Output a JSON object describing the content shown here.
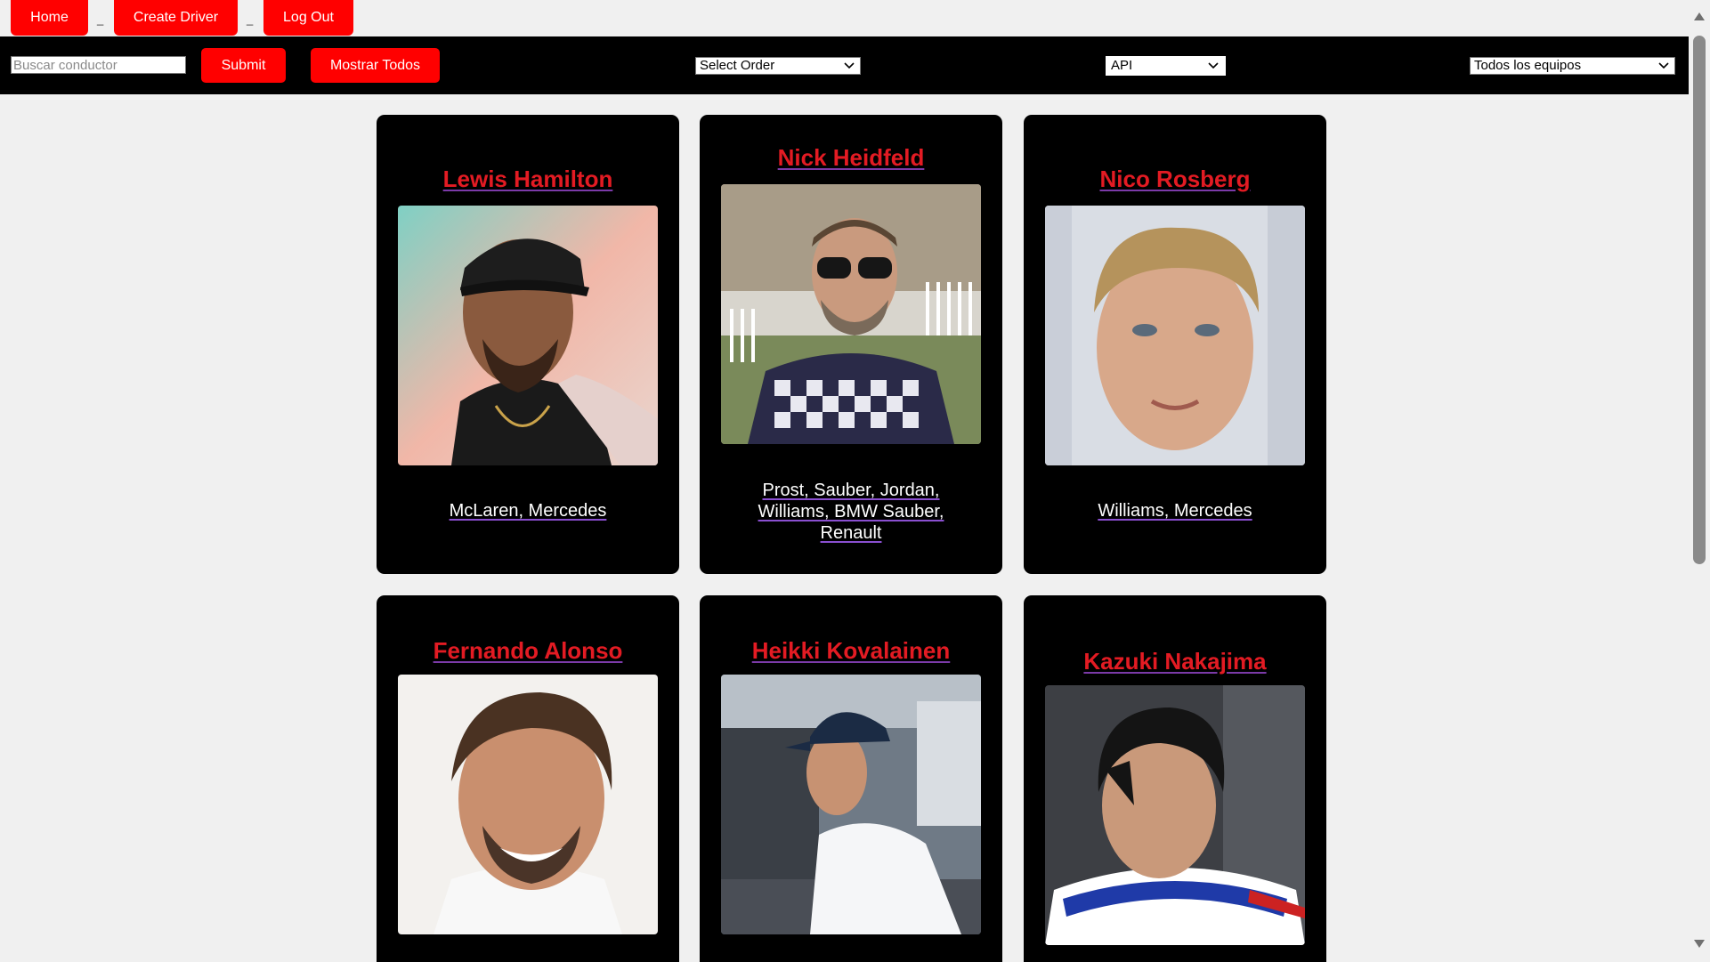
{
  "nav": {
    "home_label": "Home",
    "create_label": "Create Driver",
    "logout_label": "Log Out",
    "separator": "_"
  },
  "toolbar": {
    "search_placeholder": "Buscar conductor",
    "search_value": "",
    "submit_label": "Submit",
    "show_all_label": "Mostrar Todos",
    "order_select": "Select Order",
    "source_select": "API",
    "team_select": "Todos los equipos"
  },
  "drivers": [
    {
      "name": "Lewis Hamilton",
      "teams": "McLaren, Mercedes"
    },
    {
      "name": "Nick Heidfeld",
      "teams": "Prost, Sauber, Jordan, Williams, BMW Sauber, Renault"
    },
    {
      "name": "Nico Rosberg",
      "teams": "Williams, Mercedes"
    },
    {
      "name": "Fernando Alonso",
      "teams": ""
    },
    {
      "name": "Heikki Kovalainen",
      "teams": ""
    },
    {
      "name": "Kazuki Nakajima",
      "teams": ""
    }
  ],
  "colors": {
    "accent": "#ff0000",
    "card_bg": "#000000",
    "name_color": "#e31b23",
    "page_bg": "#f0f0f0"
  }
}
